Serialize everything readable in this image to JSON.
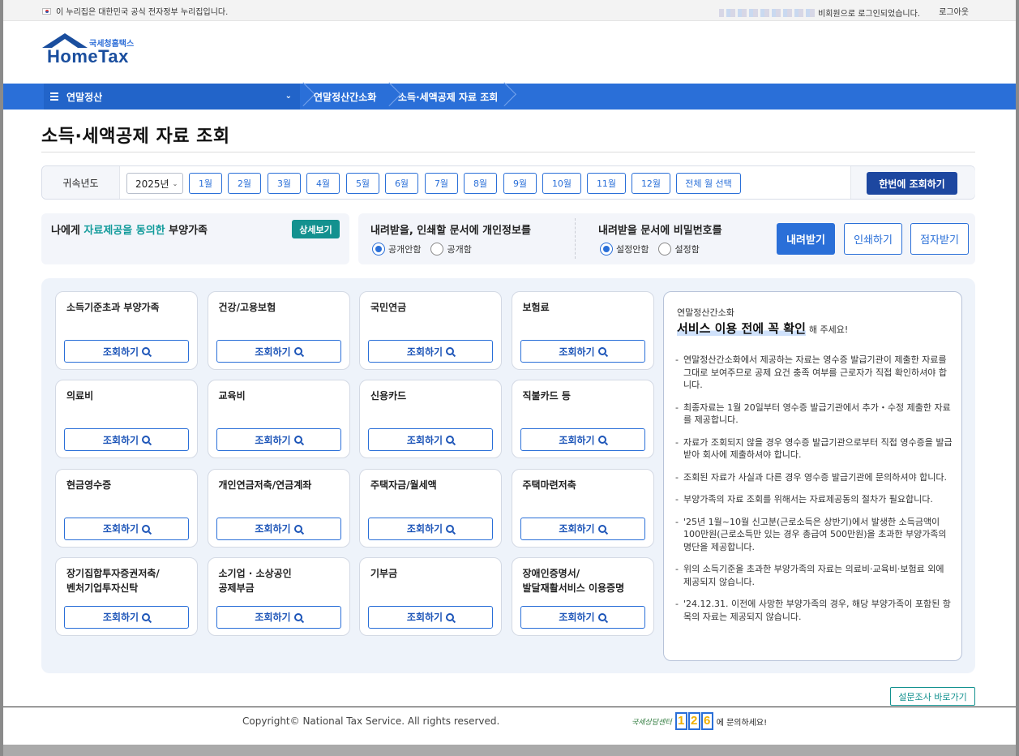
{
  "topbar": {
    "notice": "이 누리집은 대한민국 공식 전자정부 누리집입니다.",
    "login_status": "비회원으로 로그인되었습니다.",
    "logout": "로그아웃"
  },
  "logo": {
    "small": "국세청홈택스",
    "big": "HomeTax"
  },
  "nav": {
    "menu": "연말정산",
    "crumbs": [
      "연말정산간소화",
      "소득·세액공제 자료 조회"
    ]
  },
  "page_title": "소득·세액공제 자료 조회",
  "month_bar": {
    "label": "귀속년도",
    "year": "2025년",
    "months": [
      "1월",
      "2월",
      "3월",
      "4월",
      "5월",
      "6월",
      "7월",
      "8월",
      "9월",
      "10월",
      "11월",
      "12월"
    ],
    "all_months": "전체 월 선택",
    "one_click": "한번에 조회하기"
  },
  "consent": {
    "prefix": "나에게 ",
    "highlight": "자료제공을 동의한",
    "suffix": " 부양가족",
    "detail": "상세보기"
  },
  "options": {
    "personal_info": {
      "title": "내려받을, 인쇄할 문서에 개인정보를",
      "choices": [
        "공개안함",
        "공개함"
      ],
      "selected": "공개안함"
    },
    "password": {
      "title": "내려받을 문서에 비밀번호를",
      "choices": [
        "설정안함",
        "설정함"
      ],
      "selected": "설정안함"
    },
    "download": "내려받기",
    "print": "인쇄하기",
    "braille": "점자받기"
  },
  "cards": [
    [
      "소득기준초과 부양가족"
    ],
    [
      "건강/고용보험"
    ],
    [
      "국민연금"
    ],
    [
      "보험료"
    ],
    [
      "의료비"
    ],
    [
      "교육비"
    ],
    [
      "신용카드"
    ],
    [
      "직불카드 등"
    ],
    [
      "현금영수증"
    ],
    [
      "개인연금저축/연금계좌"
    ],
    [
      "주택자금/월세액"
    ],
    [
      "주택마련저축"
    ],
    [
      "장기집합투자증권저축/",
      "벤처기업투자신탁"
    ],
    [
      "소기업 · 소상공인",
      "공제부금"
    ],
    [
      "기부금"
    ],
    [
      "장애인증명서/",
      "발달재활서비스 이용증명"
    ]
  ],
  "query_label": "조회하기",
  "info": {
    "sub": "연말정산간소화",
    "head": "서비스 이용 전에 꼭 확인",
    "tail": "해 주세요!",
    "items": [
      "연말정산간소화에서 제공하는 자료는 영수증 발급기관이 제출한 자료를 그대로 보여주므로 공제 요건 충족 여부를 근로자가 직접 확인하셔야 합니다.",
      "최종자료는 1월 20일부터 영수증 발급기관에서 추가・수정 제출한 자료를 제공합니다.",
      "자료가 조회되지 않을 경우 영수증 발급기관으로부터 직접 영수증을 발급받아 회사에 제출하셔야 합니다.",
      "조회된 자료가 사실과 다른 경우 영수증 발급기관에 문의하셔야 합니다.",
      "부양가족의 자료 조회를 위해서는 자료제공동의 절차가 필요합니다.",
      "'25년 1월~10월 신고분(근로소득은 상반기)에서 발생한 소득금액이 100만원(근로소득만 있는 경우 총급여 500만원)을 초과한 부양가족의 명단을 제공합니다.",
      "위의 소득기준을 초과한 부양가족의 자료는 의료비·교육비·보험료 외에 제공되지 않습니다.",
      "'24.12.31. 이전에 사망한 부양가족의 경우, 해당 부양가족이 포함된 항목의 자료는 제공되지 않습니다."
    ]
  },
  "survey": "설문조사 바로가기",
  "footer": {
    "copyright": "Copyright© National Tax Service. All rights reserved.",
    "call_label": "국세상담센터",
    "call_digits": [
      "1",
      "2",
      "6"
    ],
    "call_suffix": "에 문의하세요!"
  },
  "colors": {
    "primary": "#2a6fd8",
    "dark": "#1d47a0",
    "teal": "#13918f"
  }
}
